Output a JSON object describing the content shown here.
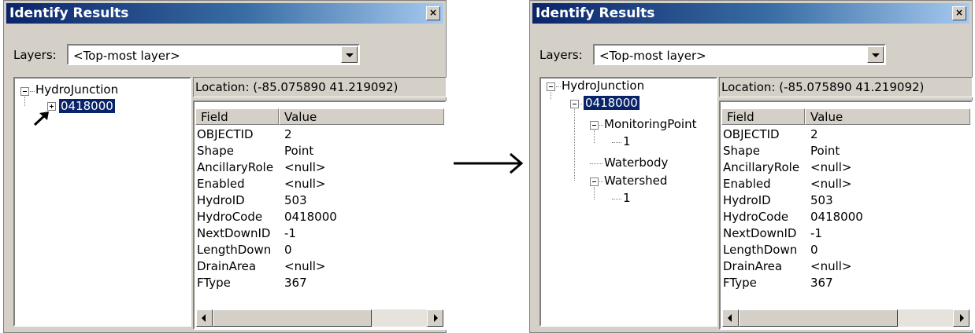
{
  "left": {
    "title": "Identify Results",
    "close": "×",
    "layers_label": "Layers:",
    "layer_value": "<Top-most layer>",
    "tree": {
      "root": "HydroJunction",
      "child": "0418000"
    },
    "location": "Location: (-85.075890 41.219092)",
    "columns": [
      "Field",
      "Value"
    ],
    "rows": [
      {
        "field": "OBJECTID",
        "value": "2"
      },
      {
        "field": "Shape",
        "value": "Point"
      },
      {
        "field": "AncillaryRole",
        "value": "<null>"
      },
      {
        "field": "Enabled",
        "value": "<null>"
      },
      {
        "field": "HydroID",
        "value": "503"
      },
      {
        "field": "HydroCode",
        "value": "0418000"
      },
      {
        "field": "NextDownID",
        "value": "-1"
      },
      {
        "field": "LengthDown",
        "value": "0"
      },
      {
        "field": "DrainArea",
        "value": "<null>"
      },
      {
        "field": "FType",
        "value": "367"
      }
    ]
  },
  "right": {
    "title": "Identify Results",
    "close": "×",
    "layers_label": "Layers:",
    "layer_value": "<Top-most layer>",
    "tree": {
      "root": "HydroJunction",
      "child": "0418000",
      "monitoring": "MonitoringPoint",
      "monitoring_child": "1",
      "waterbody": "Waterbody",
      "watershed": "Watershed",
      "watershed_child": "1"
    },
    "location": "Location: (-85.075890 41.219092)",
    "columns": [
      "Field",
      "Value"
    ],
    "rows": [
      {
        "field": "OBJECTID",
        "value": "2"
      },
      {
        "field": "Shape",
        "value": "Point"
      },
      {
        "field": "AncillaryRole",
        "value": "<null>"
      },
      {
        "field": "Enabled",
        "value": "<null>"
      },
      {
        "field": "HydroID",
        "value": "503"
      },
      {
        "field": "HydroCode",
        "value": "0418000"
      },
      {
        "field": "NextDownID",
        "value": "-1"
      },
      {
        "field": "LengthDown",
        "value": "0"
      },
      {
        "field": "DrainArea",
        "value": "<null>"
      },
      {
        "field": "FType",
        "value": "367"
      }
    ]
  },
  "colors": {
    "titlebar_start": "#0a246a",
    "titlebar_end": "#a6caf0",
    "window_bg": "#d4d0c8",
    "selection": "#0a246a"
  },
  "icons": [
    "close-icon",
    "dropdown-arrow-icon",
    "expand-icon",
    "collapse-icon",
    "pointer-arrow-icon",
    "right-arrow-icon"
  ]
}
